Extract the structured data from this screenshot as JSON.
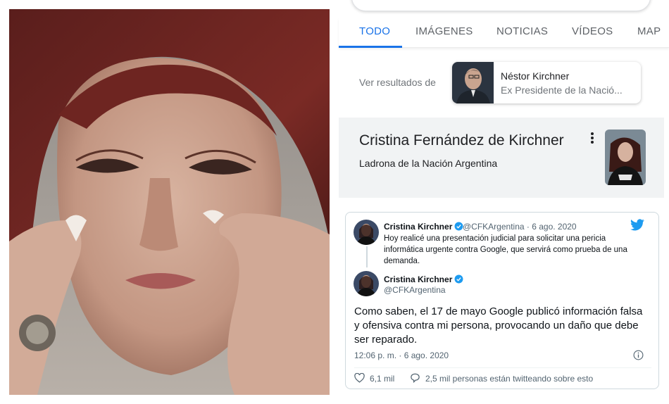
{
  "search": {
    "tabs": [
      {
        "label": "TODO"
      },
      {
        "label": "IMÁGENES"
      },
      {
        "label": "NOTICIAS"
      },
      {
        "label": "VÍDEOS"
      },
      {
        "label": "MAP"
      }
    ],
    "see_results_label": "Ver resultados de",
    "related_entity": {
      "name": "Néstor Kirchner",
      "description": "Ex Presidente de la Nació..."
    },
    "knowledge_panel": {
      "title": "Cristina Fernández de Kirchner",
      "subtitle": "Ladrona de la Nación Argentina"
    }
  },
  "tweet": {
    "quoted": {
      "author": "Cristina Kirchner",
      "handle_date": "@CFKArgentina · 6 ago. 2020",
      "text": "Hoy realicé una presentación judicial para solicitar una pericia informática urgente contra Google, que servirá como prueba de una demanda."
    },
    "main": {
      "author": "Cristina Kirchner",
      "handle": "@CFKArgentina",
      "text": "Como saben, el 17 de mayo Google publicó información falsa y ofensiva contra mi persona, provocando un daño que debe ser reparado.",
      "timestamp": "12:06 p. m. · 6 ago. 2020",
      "likes": "6,1 mil",
      "conversation": "2,5 mil personas están twitteando sobre esto"
    }
  },
  "colors": {
    "google_blue": "#1a73e8",
    "twitter_blue": "#1d9bf0",
    "panel_gray": "#f1f3f4"
  }
}
